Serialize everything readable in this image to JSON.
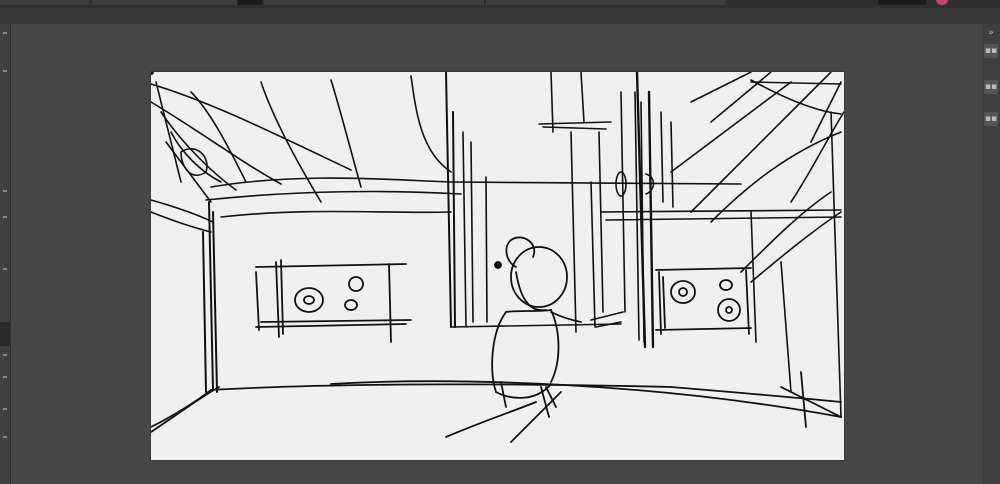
{
  "app": {
    "panel_toggle_icons": [
      "collapse-panel-icon",
      "panel-toggle-icon",
      "panel-toggle-icon",
      "panel-toggle-icon"
    ]
  },
  "canvas": {
    "background": "#f0f0f0",
    "stroke_color": "#111111"
  },
  "colors": {
    "workspace": "#474747",
    "chrome": "#3a3a3a",
    "accent": "#c0486c"
  }
}
